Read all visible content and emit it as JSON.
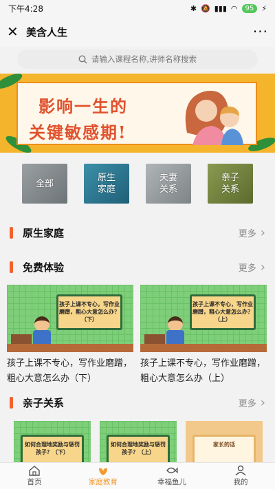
{
  "status": {
    "time": "下午4:28",
    "battery": "95"
  },
  "titlebar": {
    "title": "美含人生"
  },
  "search": {
    "placeholder": "请输入课程名称,讲师名称搜索"
  },
  "banner": {
    "line1": "影响一生的",
    "line2": "关键敏感期!"
  },
  "categories": [
    {
      "label": "全部"
    },
    {
      "label": "原生\n家庭"
    },
    {
      "label": "夫妻\n关系"
    },
    {
      "label": "亲子\n关系"
    }
  ],
  "sections": {
    "s1": {
      "title": "原生家庭",
      "more": "更多"
    },
    "s2": {
      "title": "免费体验",
      "more": "更多"
    },
    "s3": {
      "title": "亲子关系",
      "more": "更多"
    }
  },
  "free_cards": [
    {
      "board": "孩子上课不专心，写作业磨蹭，粗心大意怎么办？（下）",
      "title": "孩子上课不专心，写作业磨蹭，粗心大意怎么办（下）"
    },
    {
      "board": "孩子上课不专心，写作业磨蹭，粗心大意怎么办？（上）",
      "title": "孩子上课不专心，写作业磨蹭，粗心大意怎么办（上）"
    }
  ],
  "parent_cards": [
    {
      "board": "如何合理地奖励与惩罚孩子？（下）"
    },
    {
      "board": "如何合理地奖励与惩罚孩子？（上）"
    },
    {
      "board": "家长的话"
    }
  ],
  "tabs": [
    {
      "label": "首页",
      "icon": "home-icon"
    },
    {
      "label": "家庭教育",
      "icon": "leaf-icon",
      "active": true
    },
    {
      "label": "幸福鱼儿",
      "icon": "fish-icon"
    },
    {
      "label": "我的",
      "icon": "user-icon"
    }
  ],
  "colors": {
    "accent": "#f3622d",
    "tab_active": "#f29a2e",
    "banner": "#f4b52c"
  }
}
